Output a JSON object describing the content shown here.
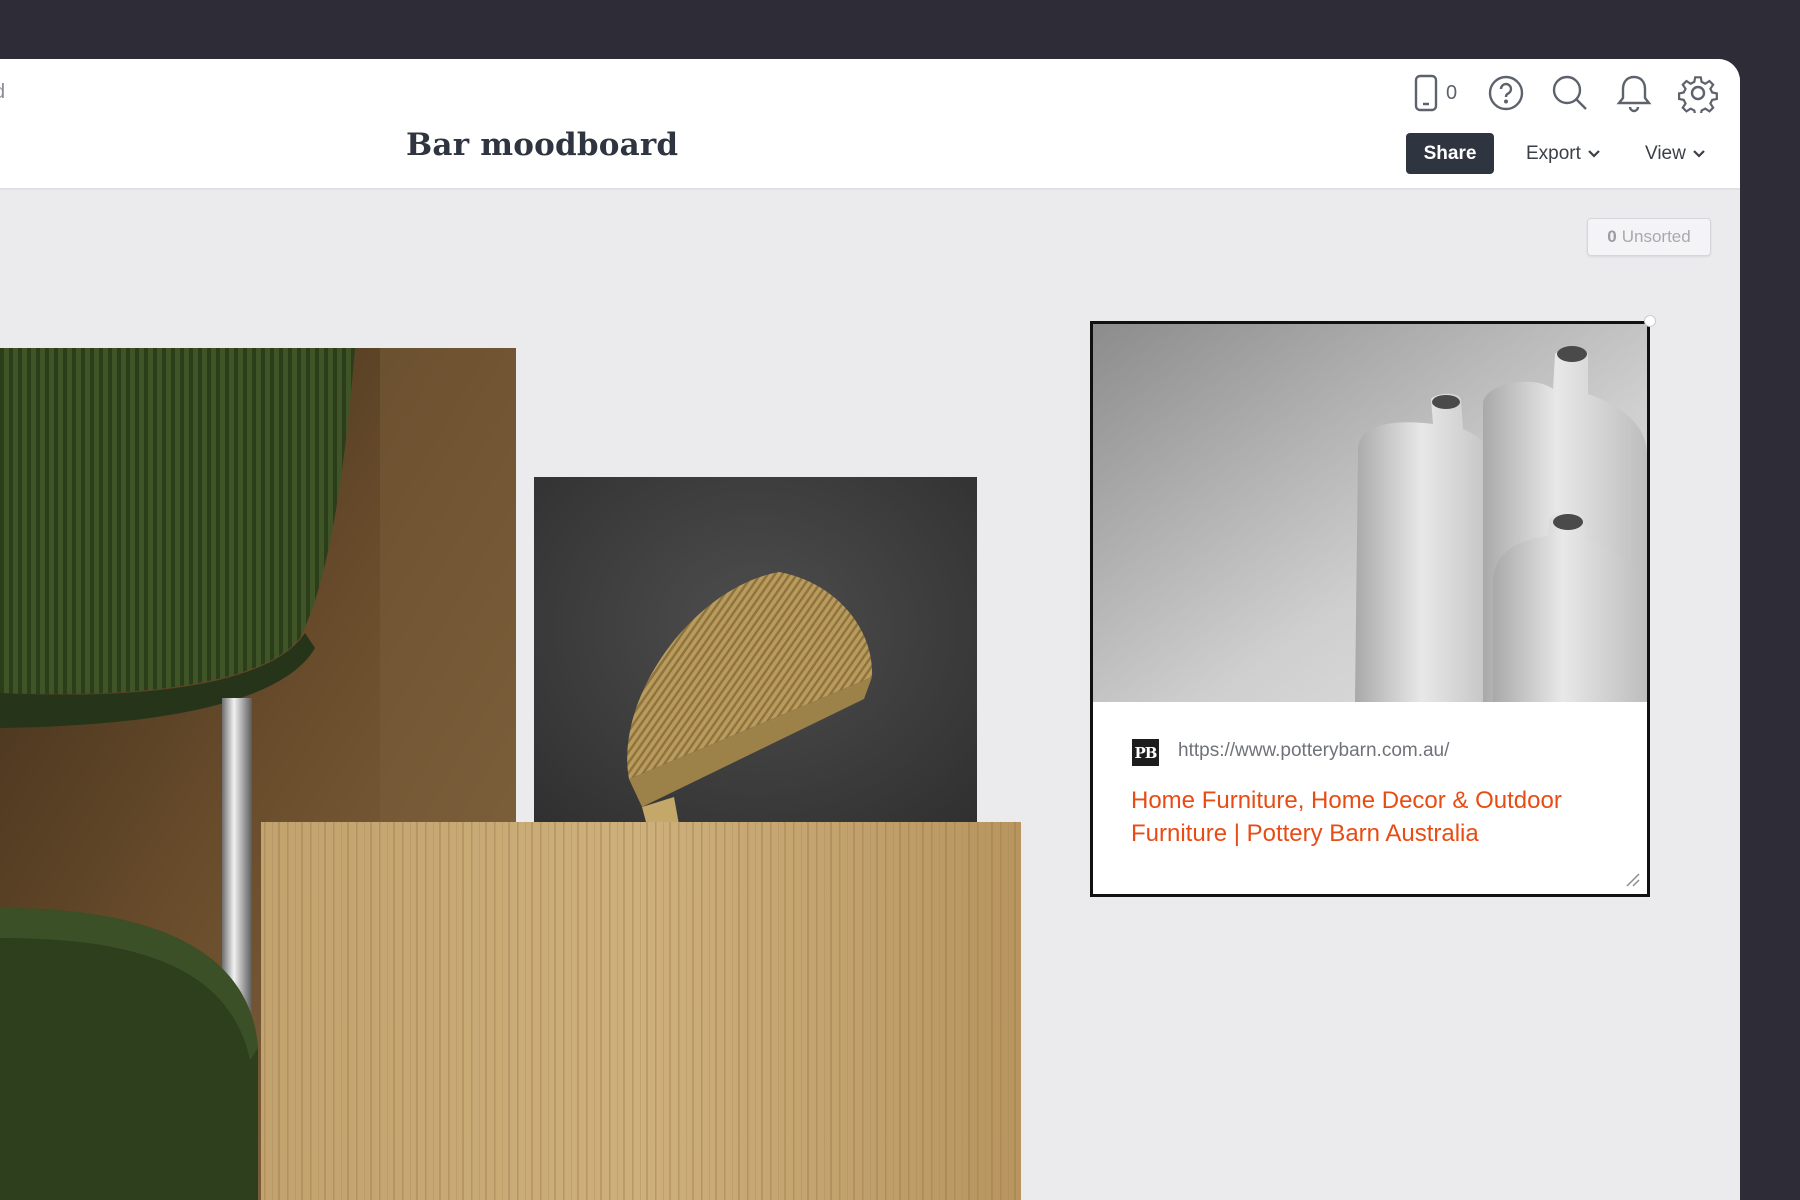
{
  "header": {
    "edge_text": "d",
    "title": "Bar moodboard",
    "device_count": "0",
    "share_label": "Share",
    "export_label": "Export",
    "view_label": "View",
    "icons": [
      "mobile-device-icon",
      "help-icon",
      "search-icon",
      "bell-icon",
      "gear-icon",
      "chevron-down-icon"
    ]
  },
  "canvas": {
    "unsorted_count": "0",
    "unsorted_label": "Unsorted",
    "tiles": [
      "green corduroy chair image",
      "brass half-moon handle image",
      "oak wood veneer image"
    ]
  },
  "link_card": {
    "favicon_text": "PB",
    "url": "https://www.potterybarn.com.au/",
    "title": "Home Furniture, Home Decor & Outdoor Furniture | Pottery Barn Australia"
  },
  "colors": {
    "frame": "#2e2d37",
    "canvas": "#ebebee",
    "share_button": "#2f3540",
    "link_title": "#e84c14"
  }
}
